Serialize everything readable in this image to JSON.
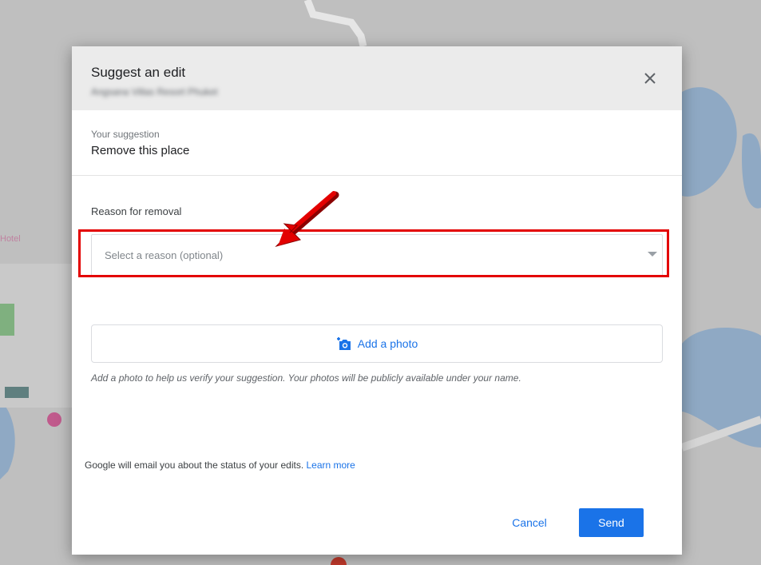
{
  "dialog": {
    "title": "Suggest an edit",
    "place_name": "Angsana Villas Resort Phuket",
    "close_icon": "close-icon"
  },
  "suggestion": {
    "label": "Your suggestion",
    "value": "Remove this place"
  },
  "reason": {
    "label": "Reason for removal",
    "placeholder": "Select a reason (optional)"
  },
  "photo": {
    "button_label": "Add a photo",
    "icon": "add-photo-camera-icon",
    "help_text": "Add a photo to help us verify your suggestion. Your photos will be publicly available under your name."
  },
  "footer": {
    "note": "Google will email you about the status of your edits. ",
    "learn_more": "Learn more"
  },
  "actions": {
    "cancel": "Cancel",
    "send": "Send"
  },
  "colors": {
    "accent": "#1a73e8",
    "highlight": "#e30000",
    "header_bg": "#ebebeb",
    "map_water": "#a8c6e8"
  }
}
